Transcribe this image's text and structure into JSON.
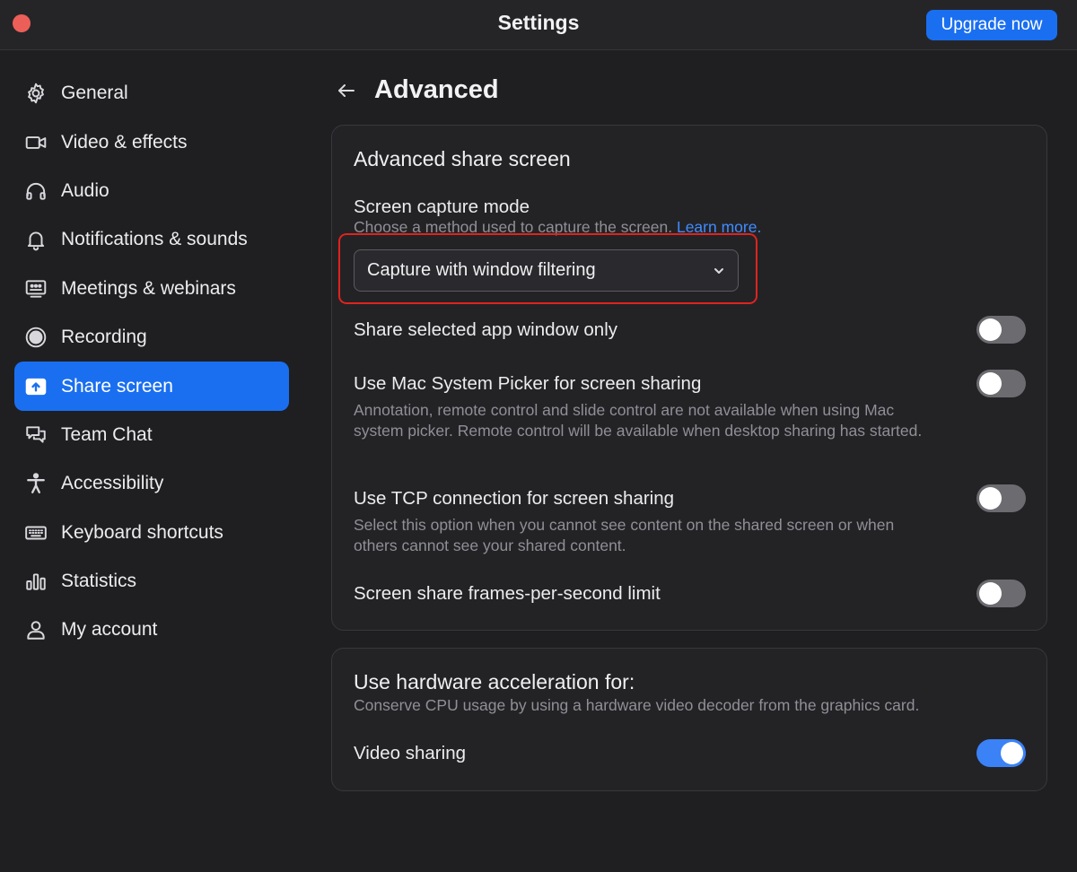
{
  "window": {
    "title": "Settings",
    "upgrade_label": "Upgrade now"
  },
  "sidebar": {
    "items": [
      {
        "label": "General",
        "icon": "gear-icon"
      },
      {
        "label": "Video & effects",
        "icon": "video-camera-icon"
      },
      {
        "label": "Audio",
        "icon": "headphones-icon"
      },
      {
        "label": "Notifications & sounds",
        "icon": "bell-icon"
      },
      {
        "label": "Meetings & webinars",
        "icon": "meetings-icon"
      },
      {
        "label": "Recording",
        "icon": "record-icon"
      },
      {
        "label": "Share screen",
        "icon": "share-screen-icon",
        "active": true
      },
      {
        "label": "Team Chat",
        "icon": "chat-bubbles-icon"
      },
      {
        "label": "Accessibility",
        "icon": "accessibility-icon"
      },
      {
        "label": "Keyboard shortcuts",
        "icon": "keyboard-icon"
      },
      {
        "label": "Statistics",
        "icon": "bar-chart-icon"
      },
      {
        "label": "My account",
        "icon": "person-icon"
      }
    ]
  },
  "main": {
    "title": "Advanced",
    "share_section": {
      "title": "Advanced share screen",
      "capture_mode": {
        "title": "Screen capture mode",
        "desc": "Choose a method used to capture the screen.",
        "link": "Learn more.",
        "value": "Capture with window filtering"
      },
      "settings": [
        {
          "title": "Share selected app window only",
          "desc": "",
          "on": false
        },
        {
          "title": "Use Mac System Picker for screen sharing",
          "desc": "Annotation, remote control and slide control are not available when using Mac system picker. Remote control will be available when desktop sharing has started.",
          "on": false
        },
        {
          "title": "Use TCP connection for screen sharing",
          "desc": "Select this option when you cannot see content on the shared screen or when others cannot see your shared content.",
          "on": false
        },
        {
          "title": "Screen share frames-per-second limit",
          "desc": "",
          "on": false
        }
      ]
    },
    "hw_section": {
      "title": "Use hardware acceleration for:",
      "desc": "Conserve CPU usage by using a hardware video decoder from the graphics card.",
      "settings": [
        {
          "title": "Video sharing",
          "on": true
        }
      ]
    }
  },
  "colors": {
    "accent": "#1a6ff0",
    "highlight": "#e0231e",
    "toggle_on": "#3b82f6",
    "toggle_off": "#6b6b70",
    "link": "#3f8cff"
  }
}
